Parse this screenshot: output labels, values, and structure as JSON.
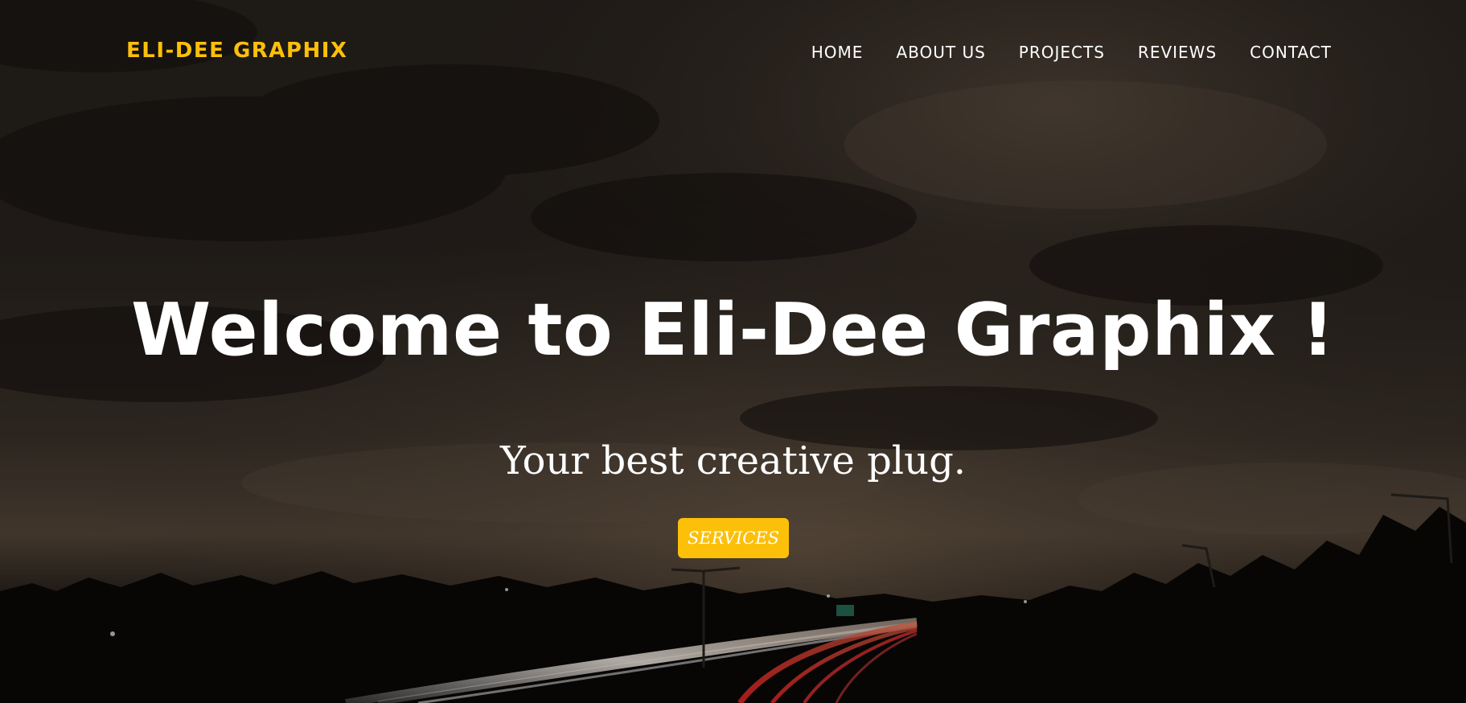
{
  "navbar": {
    "brand": "ELI-DEE GRAPHIX",
    "links": [
      {
        "label": "HOME"
      },
      {
        "label": "ABOUT US"
      },
      {
        "label": "PROJECTS"
      },
      {
        "label": "REVIEWS"
      },
      {
        "label": "CONTACT"
      }
    ]
  },
  "hero": {
    "headline": "Welcome to Eli-Dee Graphix !",
    "subhead": "Your best creative plug.",
    "cta_label": "SERVICES",
    "background": "night-highway-light-trails-photo"
  },
  "colors": {
    "accent": "#fcc00a",
    "text": "#ffffff",
    "overlay": "#1a1612"
  }
}
